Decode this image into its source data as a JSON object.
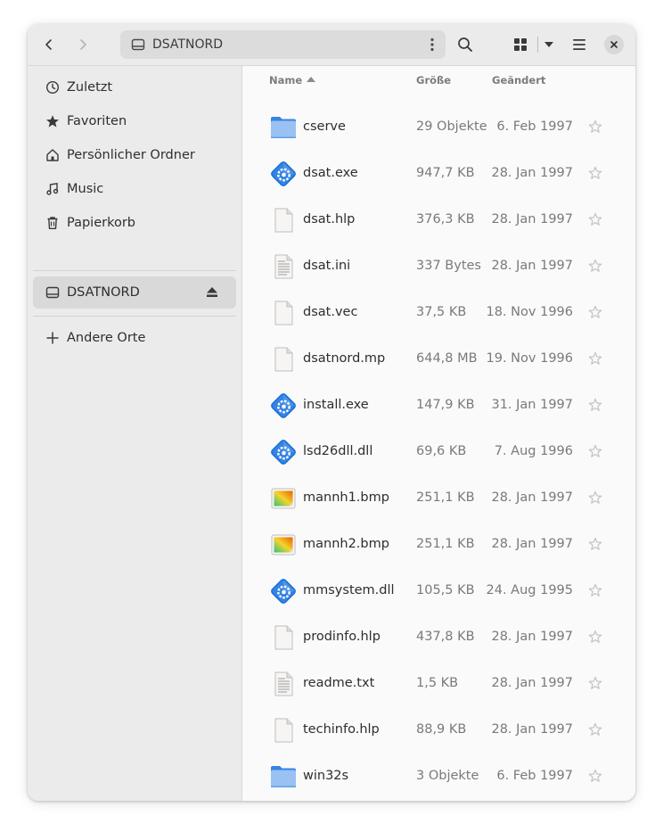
{
  "window": {
    "path_label": "DSATNORD"
  },
  "sidebar": {
    "items": [
      {
        "label": "Zuletzt",
        "icon": "clock-icon"
      },
      {
        "label": "Favoriten",
        "icon": "star-icon"
      },
      {
        "label": "Persönlicher Ordner",
        "icon": "home-icon"
      },
      {
        "label": "Music",
        "icon": "music-icon"
      },
      {
        "label": "Papierkorb",
        "icon": "trash-icon"
      }
    ],
    "drive": {
      "label": "DSATNORD",
      "icon": "drive-icon",
      "selected": true
    },
    "other": {
      "label": "Andere Orte",
      "icon": "plus-icon"
    }
  },
  "columns": {
    "name": "Name",
    "size": "Größe",
    "modified": "Geändert",
    "sort": "ascending"
  },
  "files": [
    {
      "name": "cserve",
      "size": "29 Objekte",
      "date": "6. Feb 1997",
      "type": "folder"
    },
    {
      "name": "dsat.exe",
      "size": "947,7 KB",
      "date": "28. Jan 1997",
      "type": "exe"
    },
    {
      "name": "dsat.hlp",
      "size": "376,3 KB",
      "date": "28. Jan 1997",
      "type": "blank"
    },
    {
      "name": "dsat.ini",
      "size": "337 Bytes",
      "date": "28. Jan 1997",
      "type": "text"
    },
    {
      "name": "dsat.vec",
      "size": "37,5 KB",
      "date": "18. Nov 1996",
      "type": "blank"
    },
    {
      "name": "dsatnord.mp",
      "size": "644,8 MB",
      "date": "19. Nov 1996",
      "type": "blank"
    },
    {
      "name": "install.exe",
      "size": "147,9 KB",
      "date": "31. Jan 1997",
      "type": "exe"
    },
    {
      "name": "lsd26dll.dll",
      "size": "69,6 KB",
      "date": "7. Aug 1996",
      "type": "exe"
    },
    {
      "name": "mannh1.bmp",
      "size": "251,1 KB",
      "date": "28. Jan 1997",
      "type": "image"
    },
    {
      "name": "mannh2.bmp",
      "size": "251,1 KB",
      "date": "28. Jan 1997",
      "type": "image"
    },
    {
      "name": "mmsystem.dll",
      "size": "105,5 KB",
      "date": "24. Aug 1995",
      "type": "exe"
    },
    {
      "name": "prodinfo.hlp",
      "size": "437,8 KB",
      "date": "28. Jan 1997",
      "type": "blank"
    },
    {
      "name": "readme.txt",
      "size": "1,5 KB",
      "date": "28. Jan 1997",
      "type": "text"
    },
    {
      "name": "techinfo.hlp",
      "size": "88,9 KB",
      "date": "28. Jan 1997",
      "type": "blank"
    },
    {
      "name": "win32s",
      "size": "3 Objekte",
      "date": "6. Feb 1997",
      "type": "folder"
    }
  ],
  "colors": {
    "folder": "#62a0ea",
    "exe_accent": "#3584e4",
    "headerbar": "#ebebeb",
    "sidebar": "#ebebeb"
  }
}
